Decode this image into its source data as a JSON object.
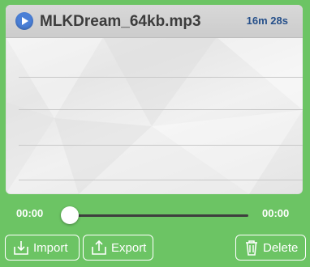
{
  "track": {
    "title": "MLKDream_64kb.mp3",
    "duration": "16m 28s"
  },
  "player": {
    "current_time": "00:00",
    "end_time": "00:00",
    "progress": 0
  },
  "actions": {
    "import_label": "Import",
    "export_label": "Export",
    "delete_label": "Delete"
  },
  "icons": {
    "play": "play-icon",
    "import": "import-icon",
    "export": "export-icon",
    "delete": "trash-icon"
  },
  "colors": {
    "background": "#6cc464",
    "accent": "#4a7fd6",
    "duration_text": "#26508a"
  }
}
